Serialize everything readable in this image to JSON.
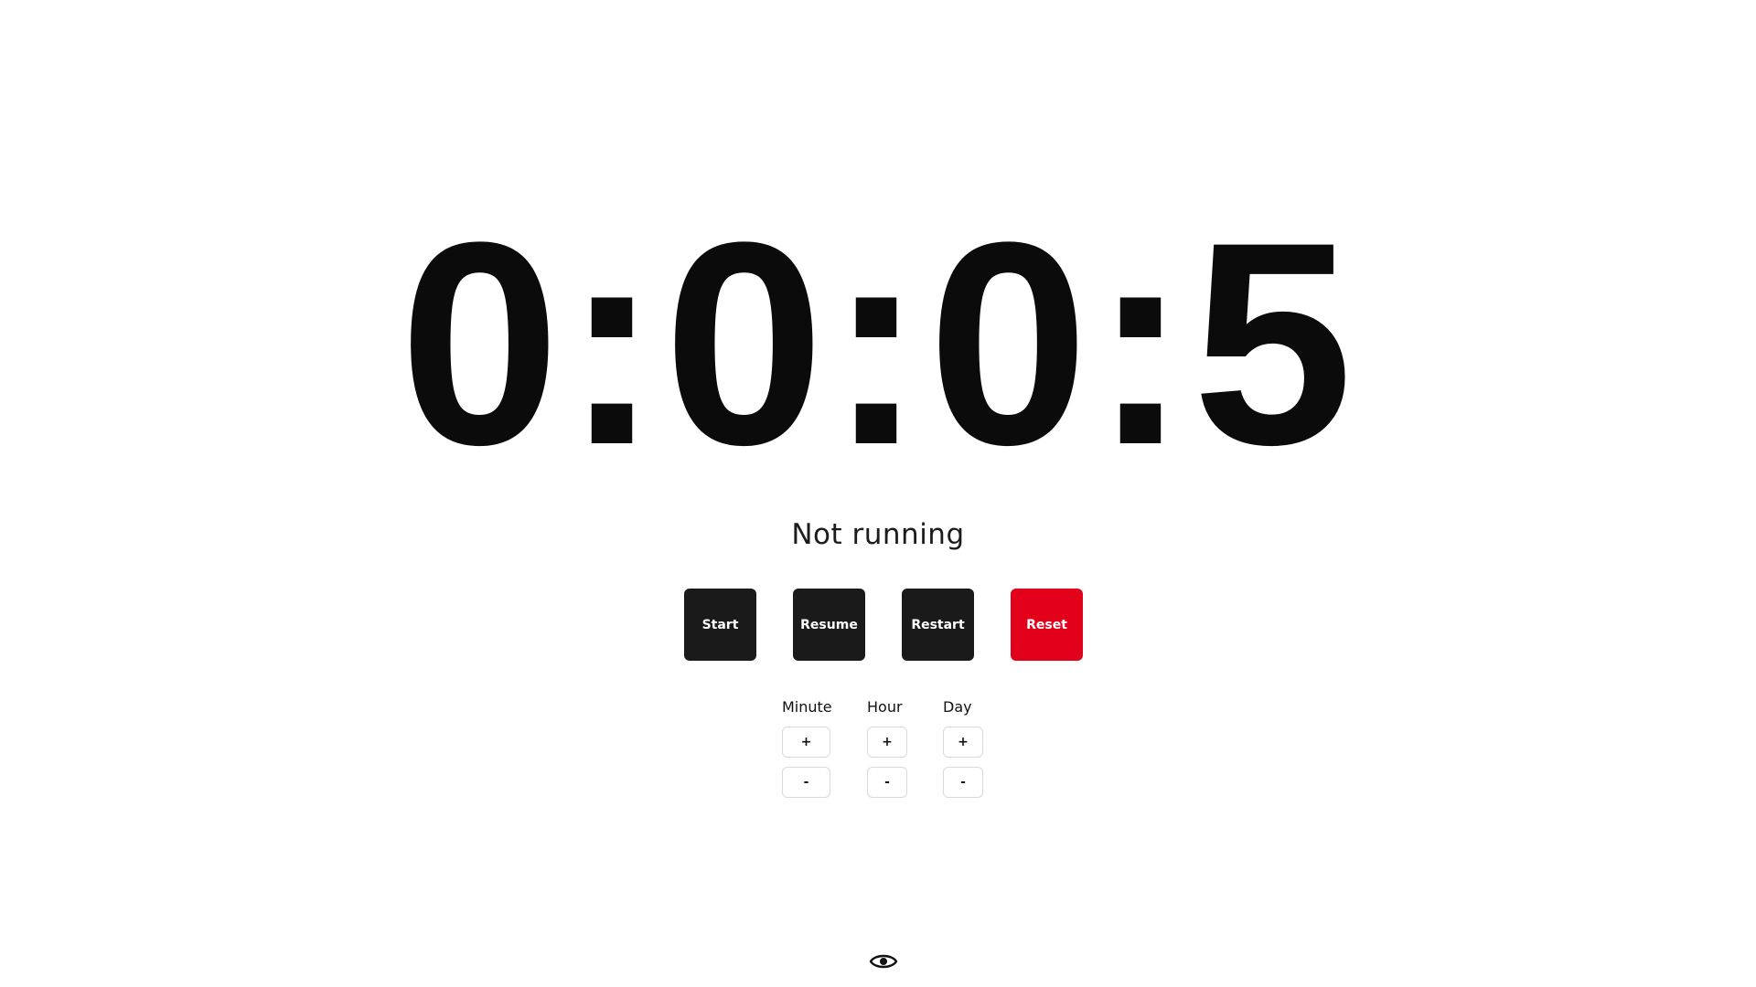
{
  "timer": {
    "display": "0:0:0:5"
  },
  "status": {
    "text": "Not running"
  },
  "controls": {
    "start_label": "Start",
    "resume_label": "Resume",
    "restart_label": "Restart",
    "reset_label": "Reset"
  },
  "adjusters": {
    "minute": {
      "label": "Minute",
      "plus": "+",
      "minus": "-"
    },
    "hour": {
      "label": "Hour",
      "plus": "+",
      "minus": "-"
    },
    "day": {
      "label": "Day",
      "plus": "+",
      "minus": "-"
    }
  },
  "icons": {
    "visibility_toggle": "eye-icon"
  },
  "colors": {
    "background": "#ffffff",
    "text": "#0b0b0b",
    "button_dark": "#1a1a1a",
    "button_reset": "#e3001b",
    "button_text": "#ffffff",
    "adjust_border": "#d9d9d9"
  }
}
